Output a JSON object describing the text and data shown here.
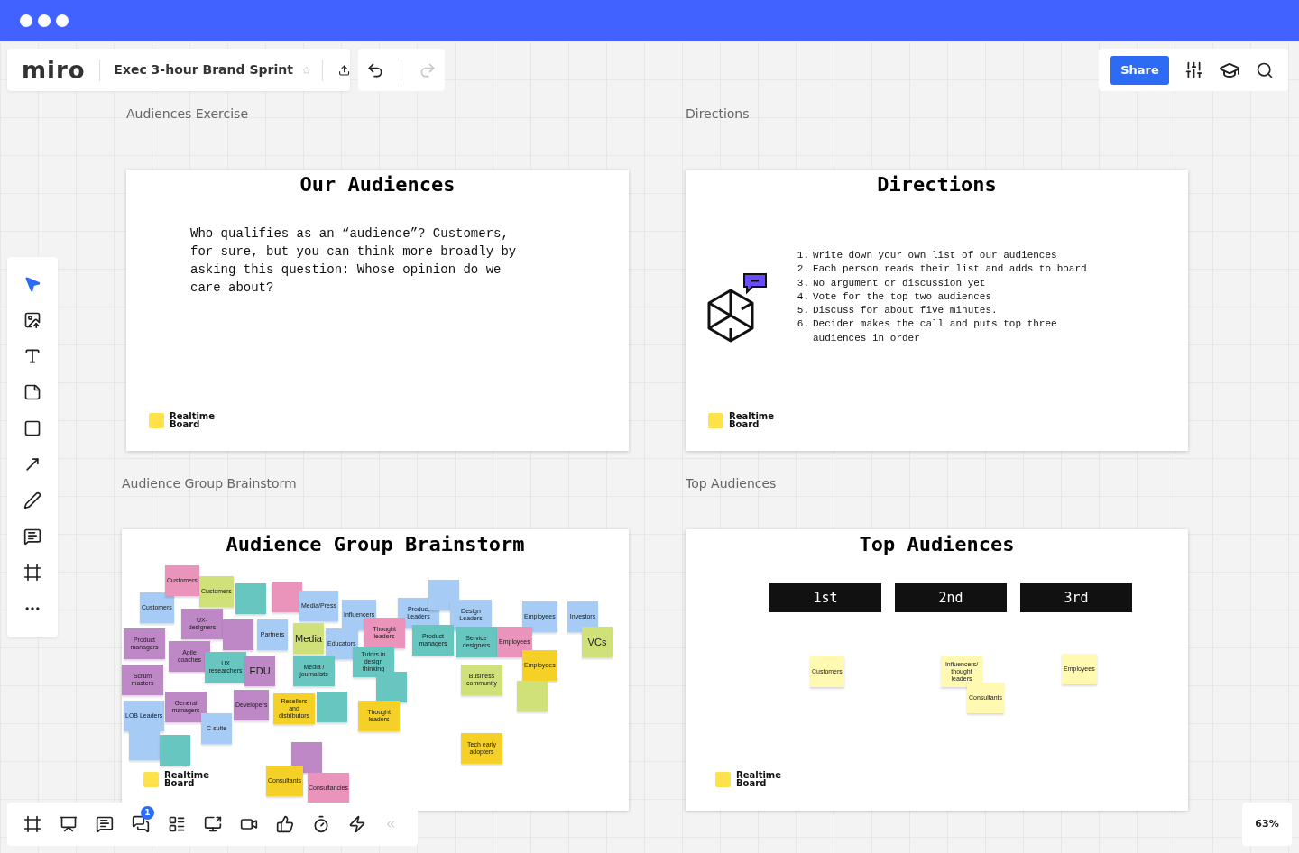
{
  "header": {
    "logo": "miro",
    "board_title": "Exec 3-hour Brand Sprint",
    "starred": false,
    "undo_disabled": false,
    "redo_disabled": true
  },
  "share_button": "Share",
  "left_toolbar": [
    {
      "selected": true
    },
    {
      "selected": false
    },
    {
      "selected": false
    },
    {
      "selected": false
    },
    {
      "selected": false
    },
    {
      "selected": false
    },
    {
      "selected": false
    },
    {
      "selected": false
    },
    {
      "selected": false
    },
    {
      "selected": false
    }
  ],
  "bottom_toolbar": {
    "chat_badge": "1"
  },
  "zoom": "63%",
  "frames": [
    {
      "kind": "text",
      "label": "Audiences Exercise",
      "title": "Our Audiences",
      "body": "Who qualifies as an “audience”? Customers, for sure, but you can think more broadly by asking this question: Whose opinion do we care about?",
      "logo_text": "Realtime Board"
    },
    {
      "kind": "list",
      "label": "Directions",
      "title": "Directions",
      "steps": [
        {
          "number": "1.",
          "text": "Write down your own list of our audiences"
        },
        {
          "number": "2.",
          "text": "Each person reads their list and adds to board"
        },
        {
          "number": "3.",
          "text": "No argument or discussion yet"
        },
        {
          "number": "4.",
          "text": "Vote for the top two audiences"
        },
        {
          "number": "5.",
          "text": "Discuss for about five minutes."
        },
        {
          "number": "6.",
          "text": "Decider makes the call and puts top three audiences in order"
        }
      ],
      "logo_text": "Realtime Board"
    },
    {
      "kind": "stickies",
      "label": "Audience Group Brainstorm",
      "title": "Audience Group Brainstorm",
      "notes": [
        {
          "text": "Customers",
          "color": "#a6ccf5"
        },
        {
          "text": "Customers",
          "color": "#ea94bb"
        },
        {
          "text": "Customers",
          "color": "#d0e17a"
        },
        {
          "color": "#67c6c0"
        },
        {
          "color": "#ea94bb"
        },
        {
          "text": "Media/Press",
          "color": "#a6ccf5"
        },
        {
          "text": "Influencers",
          "color": "#a6ccf5"
        },
        {
          "text": "Product Leaders",
          "color": "#a6ccf5"
        },
        {
          "color": "#a6ccf5"
        },
        {
          "text": "Design Leaders",
          "color": "#a6ccf5"
        },
        {
          "text": "Employees",
          "color": "#a6ccf5"
        },
        {
          "text": "Investors",
          "color": "#a6ccf5"
        },
        {
          "text": "Product managers",
          "color": "#be88c7"
        },
        {
          "text": "UX-designers",
          "color": "#be88c7"
        },
        {
          "text": "Agile coaches",
          "color": "#be88c7"
        },
        {
          "color": "#be88c7"
        },
        {
          "text": "Partners",
          "color": "#a6ccf5"
        },
        {
          "text": "Media",
          "color": "#d0e17a"
        },
        {
          "text": "Educators",
          "color": "#a6ccf5"
        },
        {
          "text": "Thought leaders",
          "color": "#ea94bb"
        },
        {
          "text": "Product managers",
          "color": "#67c6c0"
        },
        {
          "text": "Service designers",
          "color": "#67c6c0"
        },
        {
          "text": "Employees",
          "color": "#ea94bb"
        },
        {
          "text": "VCs",
          "color": "#d0e17a"
        },
        {
          "text": "Scrum masters",
          "color": "#be88c7"
        },
        {
          "text": "UX researchers",
          "color": "#67c6c0"
        },
        {
          "text": "EDU",
          "color": "#be88c7"
        },
        {
          "text": "Media / journalists",
          "color": "#67c6c0"
        },
        {
          "text": "Tutors in design thinking",
          "color": "#67c6c0"
        },
        {
          "color": "#67c6c0"
        },
        {
          "text": "Business community",
          "color": "#d0e17a"
        },
        {
          "text": "Employees",
          "color": "#f5d128"
        },
        {
          "text": "LOB Leaders",
          "color": "#a6ccf5"
        },
        {
          "text": "General managers",
          "color": "#be88c7"
        },
        {
          "text": "C-suite",
          "color": "#a6ccf5"
        },
        {
          "text": "Developers",
          "color": "#be88c7"
        },
        {
          "text": "Resellers and distributors",
          "color": "#f5d128"
        },
        {
          "color": "#67c6c0"
        },
        {
          "text": "Thought leaders",
          "color": "#f5d128"
        },
        {
          "color": "#d0e17a"
        },
        {
          "color": "#a6ccf5"
        },
        {
          "color": "#67c6c0"
        },
        {
          "color": "#be88c7"
        },
        {
          "text": "Tech early adopters",
          "color": "#f5d128"
        },
        {
          "text": "Consultants",
          "color": "#f5d128"
        },
        {
          "text": "Consultancies",
          "color": "#ea94bb"
        }
      ],
      "logo_text": "Realtime Board"
    },
    {
      "kind": "ranking",
      "label": "Top Audiences",
      "title": "Top Audiences",
      "ranks": [
        "1st",
        "2nd",
        "3rd"
      ],
      "notes": [
        {
          "text": "Customers",
          "color": "#fff9b1"
        },
        {
          "text": "Influencers/ thought leaders",
          "color": "#fff9b1"
        },
        {
          "text": "Employees",
          "color": "#fff9b1"
        },
        {
          "text": "Consultants",
          "color": "#fff9b1"
        }
      ],
      "logo_text": "Realtime Board"
    }
  ]
}
